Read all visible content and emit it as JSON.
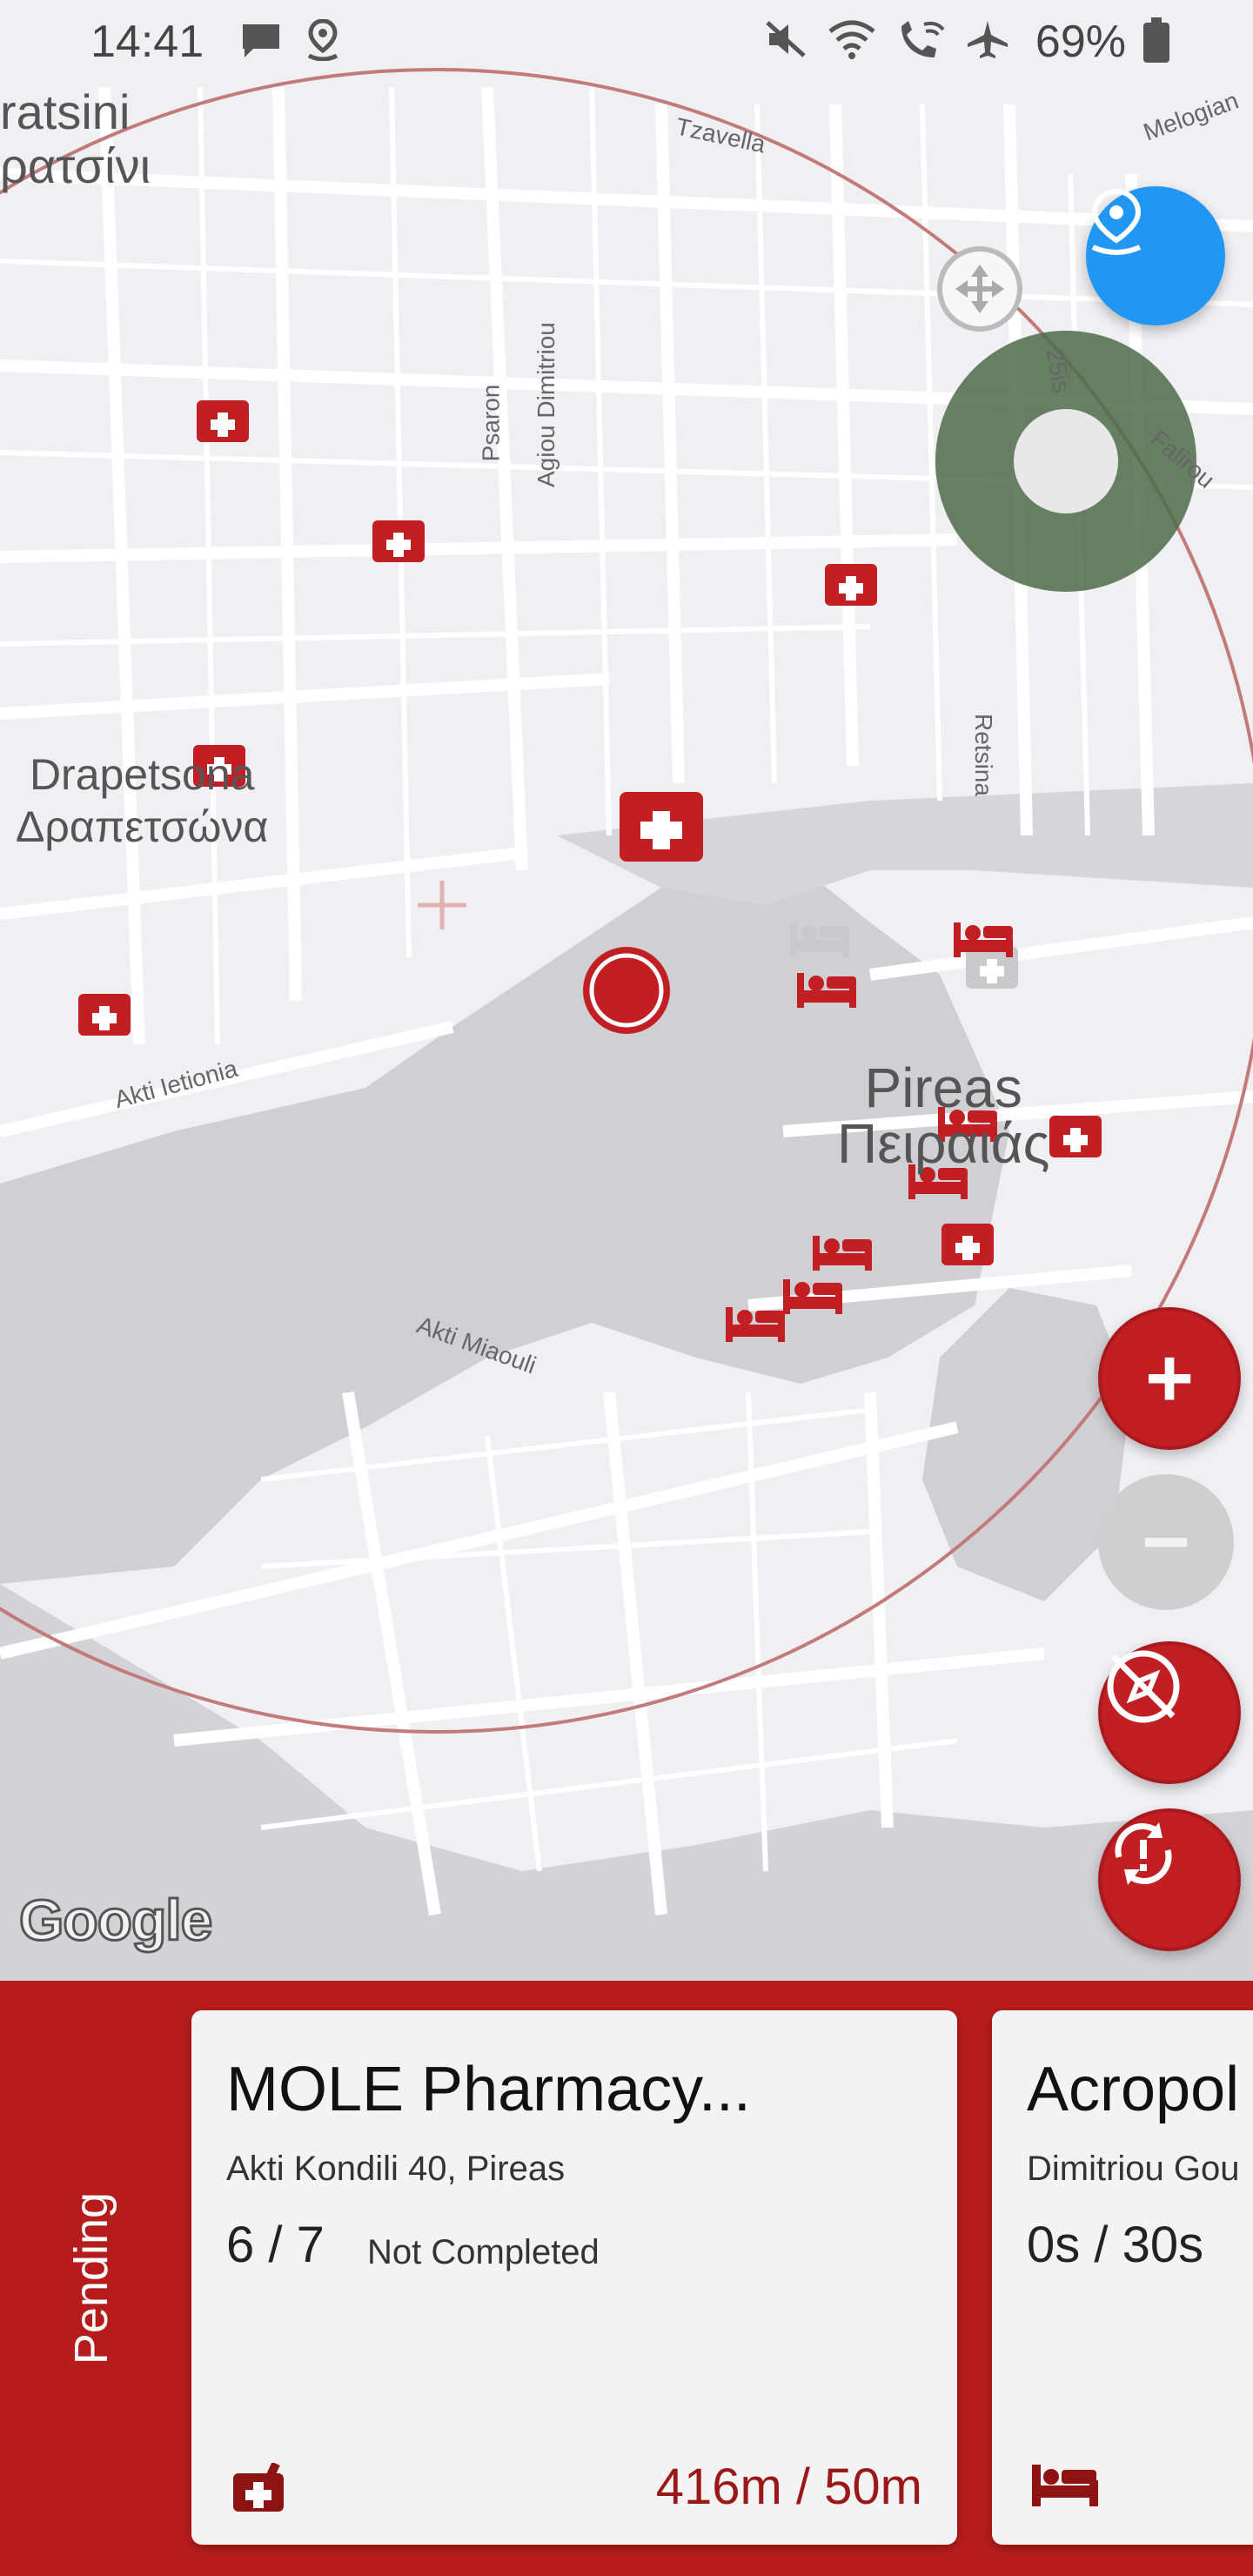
{
  "status_bar": {
    "time": "14:41",
    "battery_percent": "69%",
    "left_icons": [
      "message-icon",
      "location-icon"
    ],
    "right_icons": [
      "mute-icon",
      "wifi-icon",
      "wifi-call-icon",
      "airplane-icon",
      "battery-icon"
    ]
  },
  "map": {
    "labels": {
      "keratsini_en": "ratsini",
      "keratsini_gr": "ρατσίνι",
      "drapetsona_en": "Drapetsona",
      "drapetsona_gr": "Δραπετσώνα",
      "pireas_en": "Pireas",
      "pireas_gr": "Πειραιάς",
      "tzavella": "Tzavella",
      "melogiani": "Melogian",
      "psaron": "Psaron",
      "agiou_dimitriou": "Agiou Dimitriou",
      "retsina": "Retsina",
      "akti_ietionia": "Akti Ietionia",
      "akti_miaouli": "Akti Miaouli",
      "faliro": "Falirou",
      "twentyfive": "25is"
    },
    "google_logo": "Google",
    "controls": {
      "zoom_in": "+",
      "zoom_out": "−"
    },
    "colors": {
      "accent_red": "#c11f24",
      "range_circle": "#c27a7a",
      "blue_button": "#2196f3",
      "joystick": "#4e6b4a"
    }
  },
  "panel": {
    "tab_label": "Pending",
    "cards": [
      {
        "title": "MOLE Pharmacy...",
        "address": "Akti Kondili 40, Pireas",
        "progress": "6 / 7",
        "status": "Not Completed",
        "distance": "416m / 50m",
        "icon": "pharmacy-icon"
      },
      {
        "title": "Acropol",
        "address": "Dimitriou Gou",
        "progress": "0s / 30s",
        "status": "",
        "distance": "",
        "icon": "hotel-bed-icon"
      }
    ]
  }
}
